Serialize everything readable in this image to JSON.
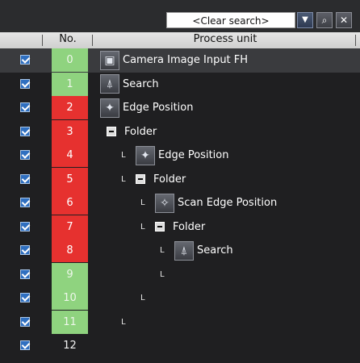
{
  "search": {
    "value": "<Clear search>",
    "dropdown_glyph": "▼",
    "find_glyph": "⌕",
    "clear_glyph": "✕"
  },
  "header": {
    "col_no": "No.",
    "col_unit": "Process unit"
  },
  "rows": [
    {
      "no": "0",
      "status": "green",
      "depth": 0,
      "kind": "unit",
      "icon": "camera-icon",
      "label": "Camera Image Input FH",
      "selected": true
    },
    {
      "no": "1",
      "status": "green",
      "depth": 0,
      "kind": "unit",
      "icon": "search-icon",
      "label": "Search"
    },
    {
      "no": "2",
      "status": "red",
      "depth": 0,
      "kind": "unit",
      "icon": "edge-icon",
      "label": "Edge Position"
    },
    {
      "no": "3",
      "status": "red",
      "depth": 0,
      "kind": "folder",
      "icon": "folder-icon",
      "label": "Folder"
    },
    {
      "no": "4",
      "status": "red",
      "depth": 1,
      "kind": "unit",
      "icon": "edge-icon",
      "label": "Edge Position"
    },
    {
      "no": "5",
      "status": "red",
      "depth": 1,
      "kind": "folder",
      "icon": "folder-icon",
      "label": "Folder"
    },
    {
      "no": "6",
      "status": "red",
      "depth": 2,
      "kind": "unit",
      "icon": "scan-edge-icon",
      "label": "Scan Edge Position"
    },
    {
      "no": "7",
      "status": "red",
      "depth": 2,
      "kind": "folder",
      "icon": "folder-icon",
      "label": "Folder"
    },
    {
      "no": "8",
      "status": "red",
      "depth": 3,
      "kind": "unit",
      "icon": "search-icon",
      "label": "Search"
    },
    {
      "no": "9",
      "status": "green",
      "depth": 3,
      "kind": "end",
      "icon": "",
      "label": ""
    },
    {
      "no": "10",
      "status": "green",
      "depth": 2,
      "kind": "end",
      "icon": "",
      "label": ""
    },
    {
      "no": "11",
      "status": "green",
      "depth": 1,
      "kind": "end",
      "icon": "",
      "label": ""
    },
    {
      "no": "12",
      "status": "none",
      "depth": 0,
      "kind": "empty",
      "icon": "",
      "label": ""
    }
  ],
  "colors": {
    "ok": "#8fd37f",
    "ng": "#e6312f",
    "checkbox": "#2f6fc0"
  }
}
